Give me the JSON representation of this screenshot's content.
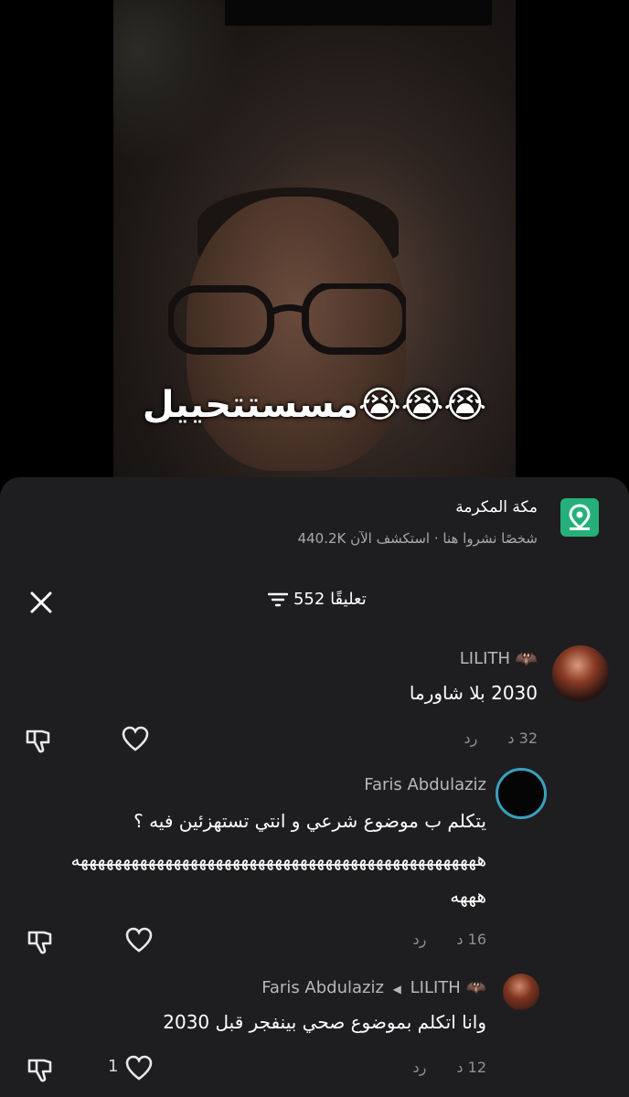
{
  "video": {
    "overlay_text": "مسستتحييل😭😭😭"
  },
  "location": {
    "title": "مكة المكرمة",
    "subtitle": "شخصًا نشروا هنا · استكشف الآن 440.2K"
  },
  "comments_header": {
    "count_label": "552 تعليقًا"
  },
  "comments": [
    {
      "username": "LILITH",
      "text": "2030 بلا شاورما",
      "time": "32 د",
      "reply": "رد"
    },
    {
      "username": "Faris Abdulaziz",
      "text": "يتكلم ب موضوع شرعي و انتي تستهزئين فيه ؟",
      "text_line2": "ههههههههههههههههههههههههههههههههههههههههههههههههه",
      "text_line3": "هههه",
      "time": "16 د",
      "reply": "رد"
    },
    {
      "username": "Faris Abdulaziz",
      "reply_to": "LILITH",
      "text": "وانا اتكلم بموضوع صحي بينفجر قبل 2030",
      "time": "12 د",
      "reply": "رد",
      "likes": "1"
    }
  ],
  "icons": [
    "location-pin-icon",
    "close-icon",
    "filter-icon",
    "dislike-icon",
    "heart-icon",
    "bat-emoji-icon",
    "reply-arrow-icon"
  ],
  "colors": {
    "sheet_bg": "#1e1e20",
    "location_badge": "#25b07a",
    "story_ring": "#3aa0c0"
  }
}
